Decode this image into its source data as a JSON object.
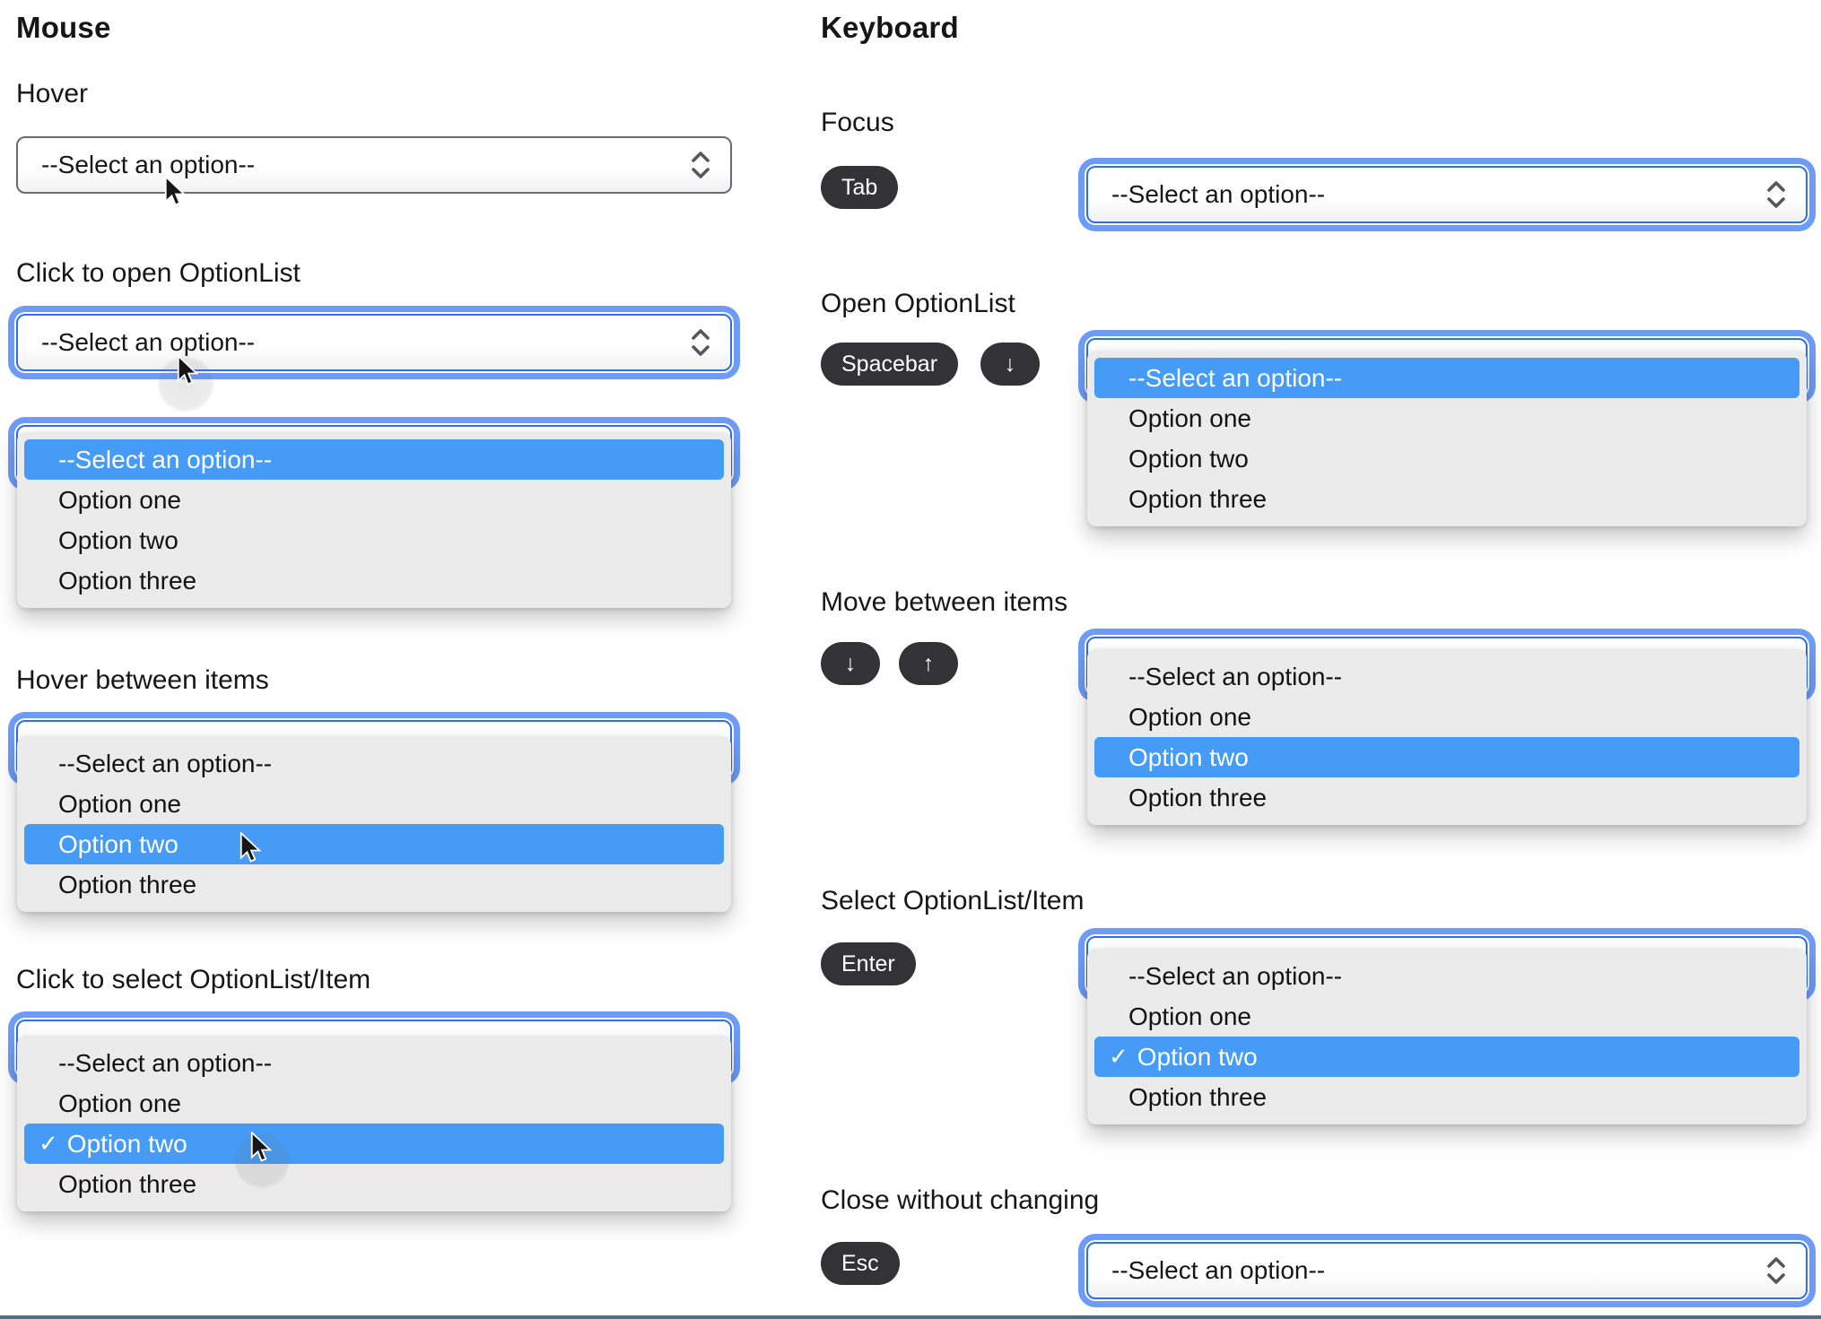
{
  "select": {
    "placeholder": "--Select an option--",
    "options": [
      "--Select an option--",
      "Option one",
      "Option two",
      "Option three"
    ],
    "checkmark_glyph": "✓"
  },
  "mouse": {
    "title": "Mouse",
    "sections": [
      {
        "title": "Hover"
      },
      {
        "title": "Click to open OptionList"
      },
      {
        "title": "Hover between items"
      },
      {
        "title": "Click to select OptionList/Item"
      }
    ]
  },
  "keyboard": {
    "title": "Keyboard",
    "sections": [
      {
        "title": "Focus",
        "keys": [
          "Tab"
        ]
      },
      {
        "title": "Open OptionList",
        "keys": [
          "Spacebar",
          "↓"
        ]
      },
      {
        "title": "Move between items",
        "keys": [
          "↓",
          "↑"
        ]
      },
      {
        "title": "Select OptionList/Item",
        "keys": [
          "Enter"
        ]
      },
      {
        "title": "Close without changing",
        "keys": [
          "Esc"
        ]
      }
    ]
  },
  "colors": {
    "option_highlight": "#459bf5",
    "focus_ring_outer": "#6d9bf7",
    "focus_ring_border": "#2d6ff2",
    "select_border": "#6a6a70",
    "panel_background": "#ebebeb",
    "key_badge_background": "#333336",
    "highlight_text": "#ffffff"
  }
}
